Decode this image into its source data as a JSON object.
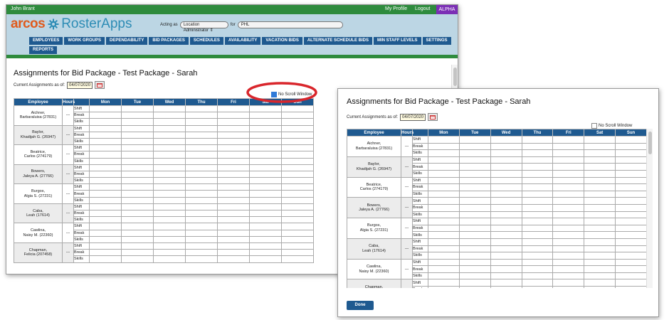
{
  "app": {
    "user": "John Brant",
    "top_links": [
      "My Profile",
      "Logout"
    ],
    "env_badge": "ALPHA",
    "logo_brand": "arcos",
    "logo_product": "RosterApps",
    "acting_as_label": "Acting as",
    "acting_as_value": "Location Administrator",
    "for_label": "for",
    "location_value": "PHL",
    "nav": [
      "EMPLOYEES",
      "WORK GROUPS",
      "DEPENDABILITY",
      "BID PACKAGES",
      "SCHEDULES",
      "AVAILABILITY",
      "VACATION BIDS",
      "ALTERNATE SCHEDULE BIDS",
      "MIN STAFF LEVELS",
      "SETTINGS",
      "REPORTS"
    ]
  },
  "page": {
    "title": "Assignments for Bid Package - Test Package - Sarah",
    "current_label": "Current Assignments as of:",
    "date": "04/07/2020",
    "no_scroll_label": "No Scroll Window",
    "done_label": "Done"
  },
  "table": {
    "headers": [
      "Employee",
      "Hours",
      "",
      "Mon",
      "Tue",
      "Wed",
      "Thu",
      "Fri",
      "Sat",
      "Sun"
    ],
    "row_labels": [
      "Shift",
      "Break",
      "Skills"
    ],
    "hours_placeholder": "---",
    "employees": [
      {
        "name": "Aichner,",
        "detail": "Barbaraluisa (27831)"
      },
      {
        "name": "Baylor,",
        "detail": "Khadijah G. (26947)"
      },
      {
        "name": "Beatrice,",
        "detail": "Carlos (274179)"
      },
      {
        "name": "Bowers,",
        "detail": "Jaleya A. (27766)"
      },
      {
        "name": "Burgos,",
        "detail": "Algia S. (27231)"
      },
      {
        "name": "Caba,",
        "detail": "Leah (17614)"
      },
      {
        "name": "Cawlina,",
        "detail": "Naisy M. (22360)"
      },
      {
        "name": "Chapman,",
        "detail": "Felicia (207458)"
      }
    ]
  },
  "colors": {
    "top_green": "#2e8b3d",
    "header_blue": "#bcd6e4",
    "nav_blue": "#1f5a90",
    "alpha_purple": "#7b2fb5",
    "logo_orange": "#e05a1c",
    "logo_blue": "#2d8cb5",
    "highlight_red": "#d9262c"
  }
}
